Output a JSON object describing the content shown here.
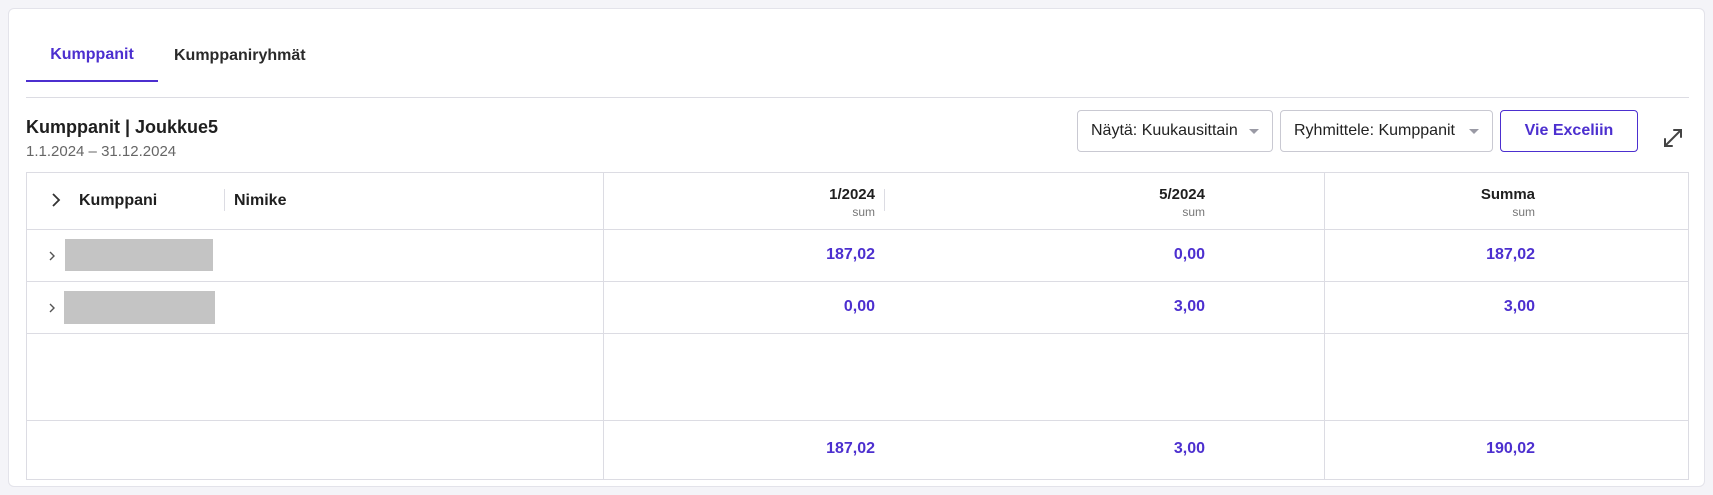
{
  "tabs": [
    {
      "label": "Kumppanit",
      "active": true
    },
    {
      "label": "Kumppaniryhmät",
      "active": false
    }
  ],
  "header": {
    "title": "Kumppanit | Joukkue5",
    "date_range": "1.1.2024 – 31.12.2024"
  },
  "toolbar": {
    "show_select": "Näytä: Kuukausittain",
    "group_select": "Ryhmittele: Kumppanit",
    "export_label": "Vie Exceliin"
  },
  "table": {
    "columns": {
      "partner": "Kumppani",
      "title": "Nimike",
      "c1": {
        "label": "1/2024",
        "sub": "sum"
      },
      "c2": {
        "label": "5/2024",
        "sub": "sum"
      },
      "c3": {
        "label": "Summa",
        "sub": "sum"
      }
    },
    "rows": [
      {
        "c1": "187,02",
        "c2": "0,00",
        "c3": "187,02"
      },
      {
        "c1": "0,00",
        "c2": "3,00",
        "c3": "3,00"
      }
    ],
    "totals": {
      "c1": "187,02",
      "c2": "3,00",
      "c3": "190,02"
    }
  },
  "colors": {
    "accent": "#4c2fcf",
    "border": "#dcdce3",
    "redacted": "#c4c4c4"
  },
  "icons": [
    "chevron-right-icon",
    "caret-down-icon",
    "expand-icon"
  ]
}
